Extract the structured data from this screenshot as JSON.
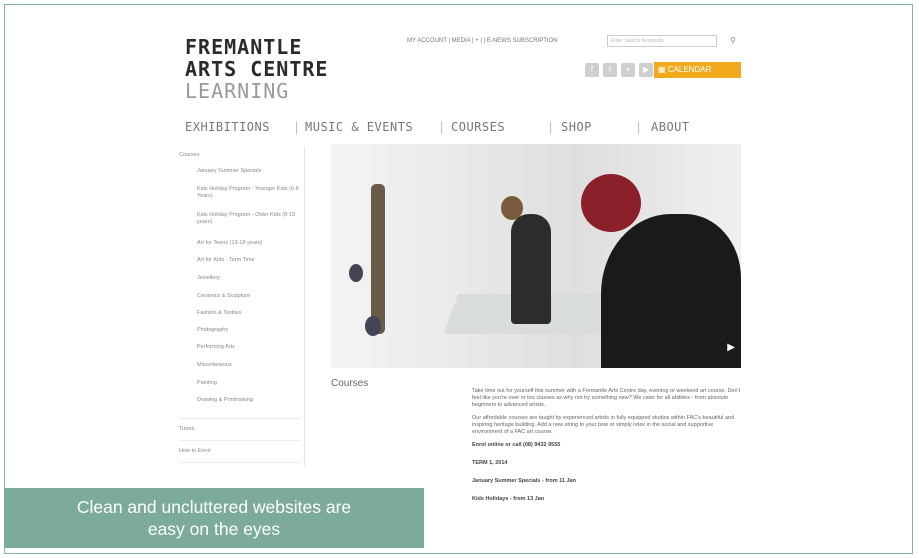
{
  "logo": {
    "line1": "FREMANTLE",
    "line2": "ARTS CENTRE",
    "line3": "LEARNING"
  },
  "header": {
    "toplinks": "MY ACCOUNT | MEDIA | + | | E-NEWS SUBSCRIPTION",
    "search_placeholder": "Enter Search Keywords",
    "calendar_label": "CALENDAR",
    "social_icons": [
      "facebook-icon",
      "twitter-icon",
      "flickr-icon",
      "youtube-icon"
    ]
  },
  "nav": {
    "items": [
      "EXHIBITIONS",
      "MUSIC & EVENTS",
      "COURSES",
      "SHOP",
      "ABOUT"
    ],
    "separator": "|"
  },
  "sidebar": {
    "items": [
      "Courses",
      "January Summer Specials",
      "Kids Holiday Program - Younger Kids (6-8 Years)",
      "Kids Holiday Program - Older Kids (8-13 years)",
      "Art for Teens (13-18 years)",
      "Art for Kids - Term Time",
      "Jewellery",
      "Ceramics & Sculpture",
      "Fashion & Textiles",
      "Photography",
      "Performing Arts",
      "Miscellaneous",
      "Painting",
      "Drawing & Printmaking",
      "Tutors",
      "How to Enrol"
    ]
  },
  "main": {
    "section_title": "Courses",
    "paragraphs": [
      "Take time out for yourself this summer with a Fremantle Arts Centre day, evening or weekend art course. Don't feel like you're over or too classes as why not try something new? We cater for all abilities - from absolute beginners to advanced artists.",
      "Our affordable courses are taught by experienced artists in fully equipped studios within FAC's beautiful and inspiring heritage building. Add a new string to your bow or simply relax in the social and supportive environment of a FAC art course."
    ],
    "links": [
      "Enrol online or call (08) 9432 9555",
      "TERM 1, 2014",
      "January Summer Specials - from 11 Jan",
      "Kids Holidays - from 13 Jan"
    ]
  },
  "caption": {
    "line1": "Clean and uncluttered websites are",
    "line2": "easy on the eyes"
  }
}
